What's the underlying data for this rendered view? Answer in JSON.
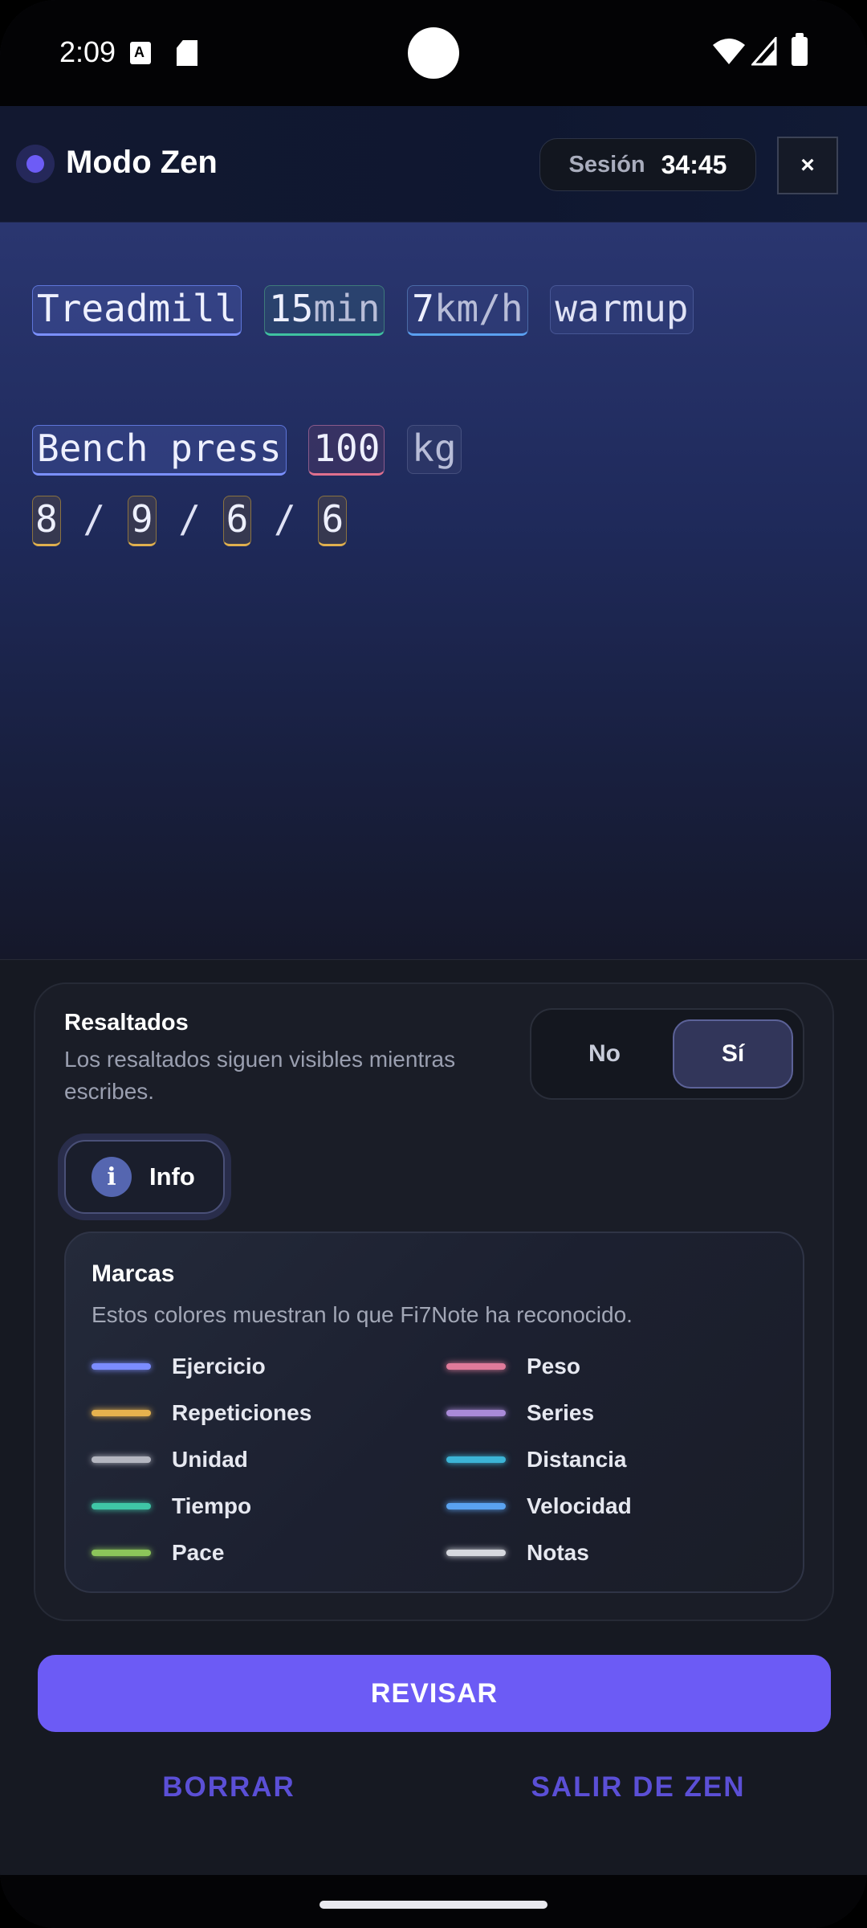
{
  "status_bar": {
    "time": "2:09",
    "icons": [
      "a-notification-icon",
      "sd-card-icon",
      "wifi-icon",
      "signal-icon",
      "battery-icon"
    ]
  },
  "header": {
    "title": "Modo Zen",
    "session_label": "Sesión",
    "session_time": "34:45",
    "close": "×"
  },
  "editor": {
    "line1": {
      "exercise": "Treadmill",
      "time_num": "15",
      "time_unit": "min",
      "speed_num": "7",
      "speed_unit": "km/h",
      "note": "warmup"
    },
    "line2": {
      "exercise": "Bench press",
      "weight": "100",
      "unit": "kg"
    },
    "line3": {
      "reps": [
        "8",
        "9",
        "6",
        "6"
      ],
      "separator": "/"
    }
  },
  "highlights": {
    "title": "Resaltados",
    "description": "Los resaltados siguen visibles mientras escribes.",
    "option_no": "No",
    "option_si": "Sí",
    "selected": "Sí"
  },
  "info_button": {
    "icon": "i",
    "label": "Info"
  },
  "legend": {
    "title": "Marcas",
    "description": "Estos colores muestran lo que Fi7Note ha reconocido.",
    "items": [
      {
        "label": "Ejercicio",
        "color": "#7b8cff"
      },
      {
        "label": "Peso",
        "color": "#e07a9a"
      },
      {
        "label": "Repeticiones",
        "color": "#e6b24e"
      },
      {
        "label": "Series",
        "color": "#a98ad8"
      },
      {
        "label": "Unidad",
        "color": "#b4b6c0"
      },
      {
        "label": "Distancia",
        "color": "#3cb4d6"
      },
      {
        "label": "Tiempo",
        "color": "#3fc6a6"
      },
      {
        "label": "Velocidad",
        "color": "#5aa2f0"
      },
      {
        "label": "Pace",
        "color": "#8cc65a"
      },
      {
        "label": "Notas",
        "color": "#d6d8de"
      }
    ]
  },
  "actions": {
    "review": "REVISAR",
    "clear": "BORRAR",
    "exit": "SALIR DE ZEN"
  },
  "colors": {
    "accent": "#6c5bf5",
    "link": "#5b4fd6"
  }
}
